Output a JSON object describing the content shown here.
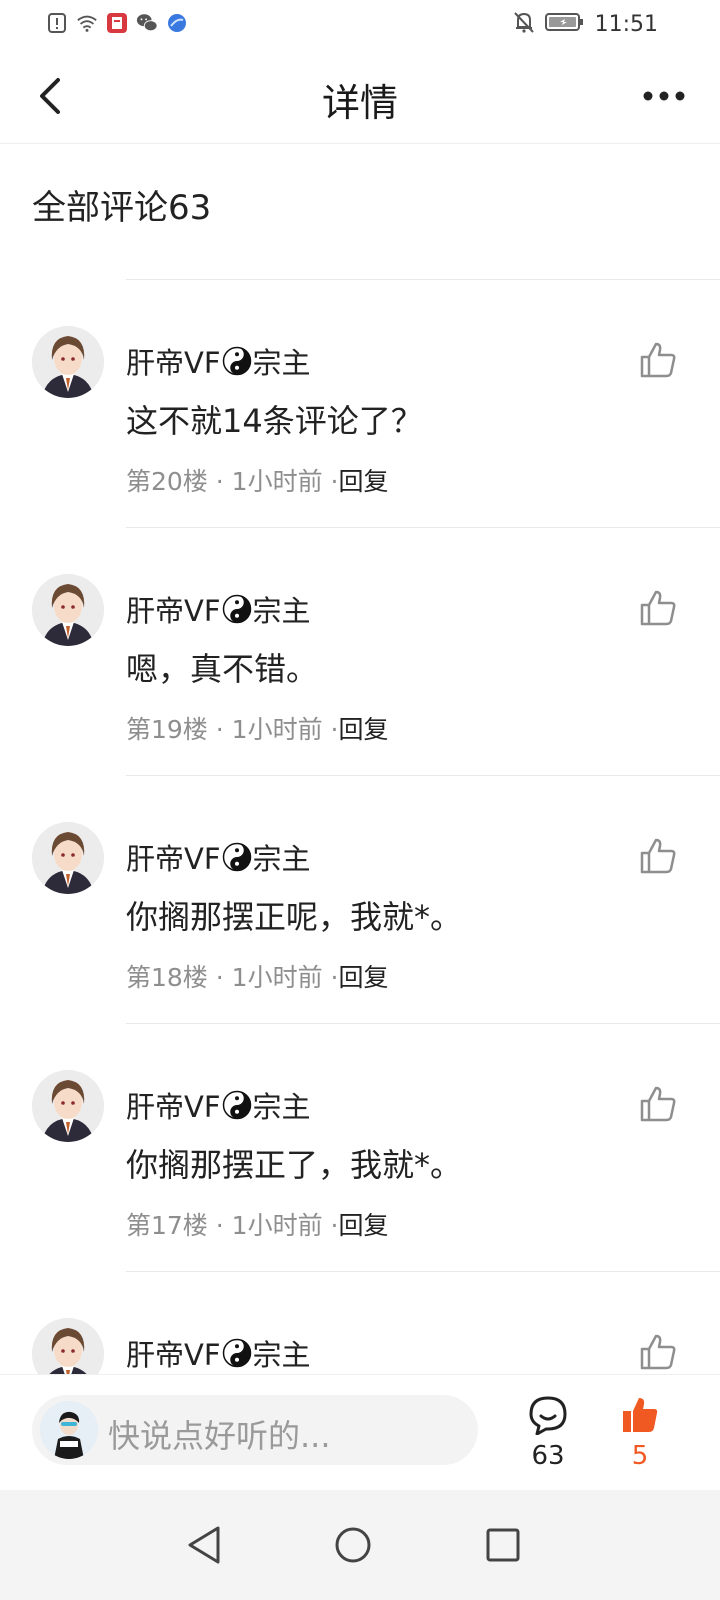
{
  "status_bar": {
    "time": "11:51",
    "icons": [
      "alert-icon",
      "wifi-icon",
      "app-notification-icon",
      "wechat-icon",
      "browser-icon",
      "mute-icon",
      "battery-icon"
    ]
  },
  "header": {
    "title": "详情",
    "back_icon": "chevron-left-icon",
    "more_icon": "more-dots-icon"
  },
  "section": {
    "title": "全部评论63"
  },
  "comments": [
    {
      "name_prefix": "肝帝VF",
      "name_suffix": "宗主",
      "text": "这不就14条评论了？",
      "floor": "第20楼",
      "time": "1小时前",
      "reply": "回复"
    },
    {
      "name_prefix": "肝帝VF",
      "name_suffix": "宗主",
      "text": "嗯，真不错。",
      "floor": "第19楼",
      "time": "1小时前",
      "reply": "回复"
    },
    {
      "name_prefix": "肝帝VF",
      "name_suffix": "宗主",
      "text": "你搁那摆正呢，我就*。",
      "floor": "第18楼",
      "time": "1小时前",
      "reply": "回复"
    },
    {
      "name_prefix": "肝帝VF",
      "name_suffix": "宗主",
      "text": "你搁那摆正了，我就*。",
      "floor": "第17楼",
      "time": "1小时前",
      "reply": "回复"
    },
    {
      "name_prefix": "肝帝VF",
      "name_suffix": "宗主"
    }
  ],
  "bottom_bar": {
    "placeholder": "快说点好听的...",
    "comment_count": "63",
    "like_count": "5"
  },
  "colors": {
    "accent": "#f05a22",
    "muted": "#8e8e8e",
    "divider": "#e8e8e8"
  }
}
